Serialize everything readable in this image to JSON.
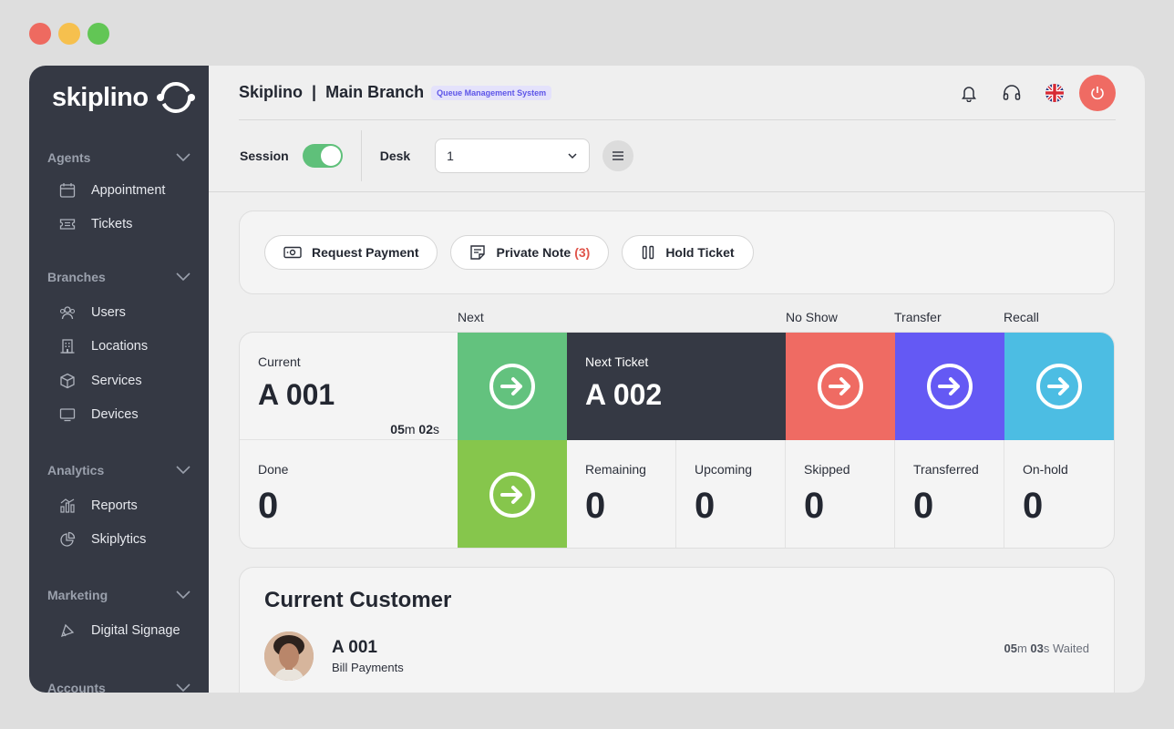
{
  "window_controls": {
    "close_color": "#ee6a60",
    "minimize_color": "#f6c04e",
    "maximize_color": "#62c655"
  },
  "sidebar": {
    "logo_text": "skiplino",
    "sections": [
      {
        "title": "Agents",
        "items": [
          {
            "label": "Appointment",
            "icon": "calendar-icon"
          },
          {
            "label": "Tickets",
            "icon": "ticket-icon"
          }
        ]
      },
      {
        "title": "Branches",
        "items": [
          {
            "label": "Users",
            "icon": "users-icon"
          },
          {
            "label": "Locations",
            "icon": "building-icon"
          },
          {
            "label": "Services",
            "icon": "box-icon"
          },
          {
            "label": "Devices",
            "icon": "monitor-icon"
          }
        ]
      },
      {
        "title": "Analytics",
        "items": [
          {
            "label": "Reports",
            "icon": "chart-icon"
          },
          {
            "label": "Skiplytics",
            "icon": "pie-icon"
          }
        ]
      },
      {
        "title": "Marketing",
        "items": [
          {
            "label": "Digital Signage",
            "icon": "signage-icon"
          }
        ]
      },
      {
        "title": "Accounts",
        "items": []
      }
    ]
  },
  "header": {
    "title_company": "Skiplino",
    "title_sep": "|",
    "title_branch": "Main Branch",
    "tag": "Queue Management System"
  },
  "toolbar": {
    "session_label": "Session",
    "session_on": true,
    "desk_label": "Desk",
    "desk_value": "1"
  },
  "actions": [
    {
      "label": "Request Payment",
      "icon": "money-icon"
    },
    {
      "label": "Private Note",
      "count": "(3)",
      "icon": "note-icon"
    },
    {
      "label": "Hold Ticket",
      "icon": "pause-icon"
    }
  ],
  "columns": {
    "next": "Next",
    "no_show": "No Show",
    "transfer": "Transfer",
    "recall": "Recall"
  },
  "colors": {
    "next": "#63c27e",
    "done": "#86c64c",
    "no_show": "#ef6b63",
    "transfer": "#6459f4",
    "recall": "#4cbde3",
    "next_ticket_bg": "#353944"
  },
  "current": {
    "label": "Current",
    "ticket": "A 001",
    "timer_min": "05",
    "timer_min_unit": "m",
    "timer_sec": "02",
    "timer_sec_unit": "s"
  },
  "next_ticket": {
    "label": "Next Ticket",
    "ticket": "A 002"
  },
  "stats": {
    "done": {
      "label": "Done",
      "value": "0"
    },
    "remaining": {
      "label": "Remaining",
      "value": "0"
    },
    "upcoming": {
      "label": "Upcoming",
      "value": "0"
    },
    "skipped": {
      "label": "Skipped",
      "value": "0"
    },
    "transferred": {
      "label": "Transferred",
      "value": "0"
    },
    "on_hold": {
      "label": "On-hold",
      "value": "0"
    }
  },
  "customer": {
    "title": "Current Customer",
    "ticket": "A 001",
    "service": "Bill Payments",
    "waited_min": "05",
    "waited_min_unit": "m",
    "waited_sec": "03",
    "waited_sec_unit": "s",
    "waited_suffix": "Waited"
  }
}
